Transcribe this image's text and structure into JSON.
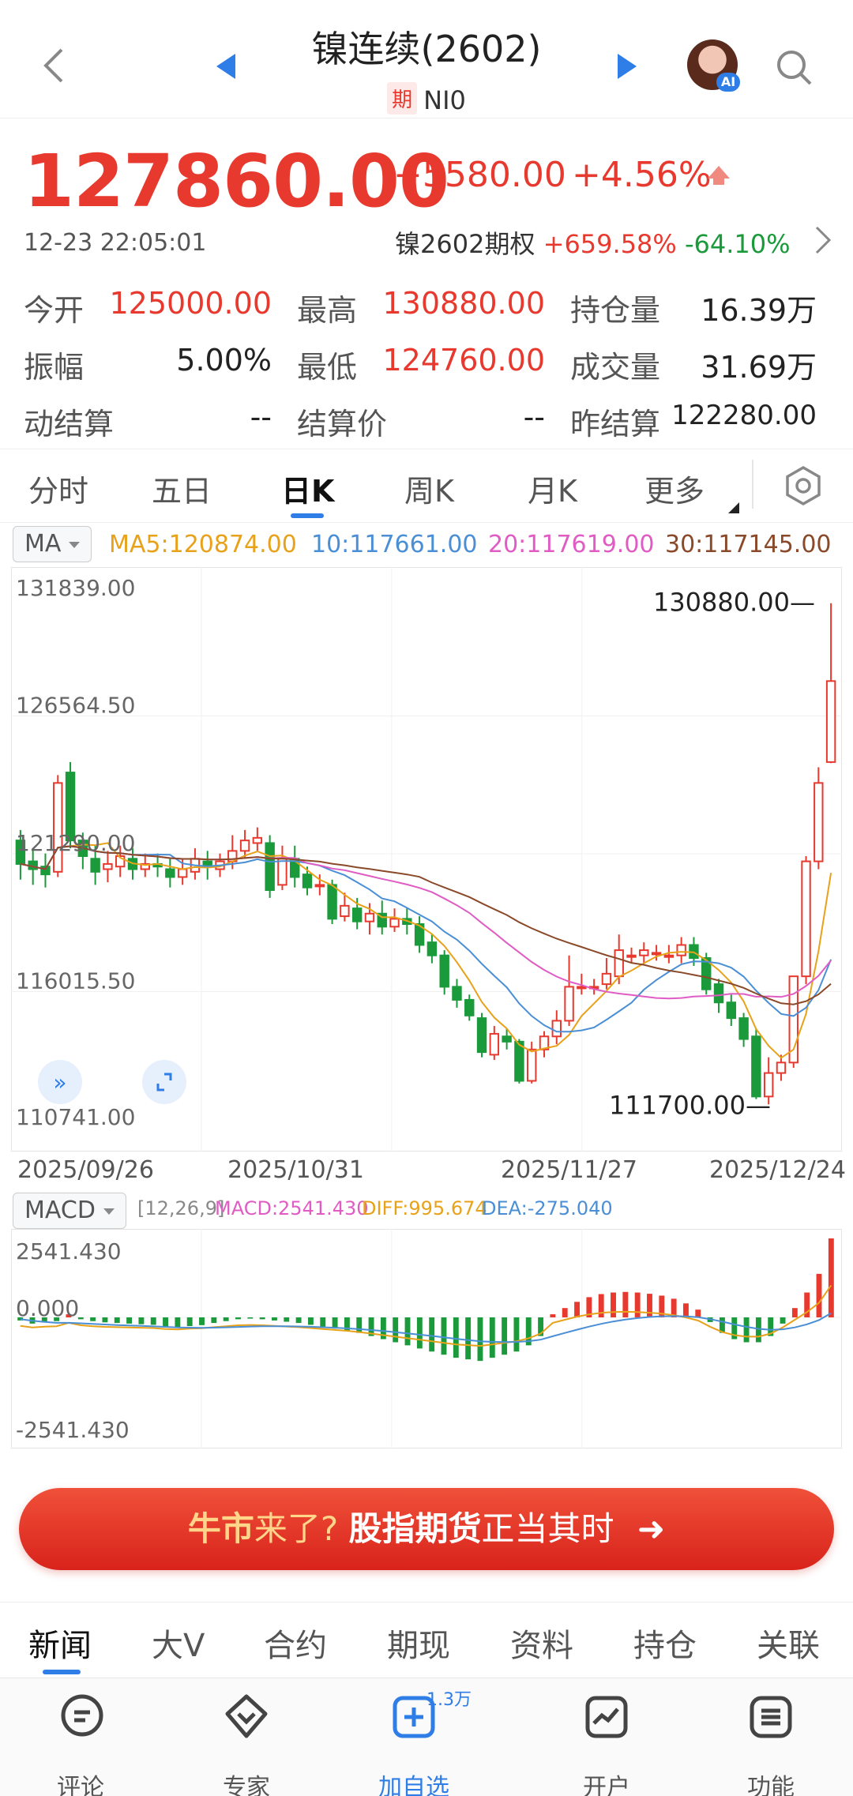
{
  "header": {
    "title": "镍连续(2602)",
    "tag": "期",
    "subtitle": "NI0",
    "ai_badge": "AI"
  },
  "quote": {
    "price": "127860.00",
    "change": "+5580.00",
    "change_pct": "+4.56%",
    "time": "12-23 22:05:01",
    "option_label": "镍2602期权",
    "option_up": "+659.58%",
    "option_down": "-64.10%"
  },
  "stats": [
    {
      "label": "今开",
      "value": "125000.00",
      "color": "red"
    },
    {
      "label": "最高",
      "value": "130880.00",
      "color": "red"
    },
    {
      "label": "持仓量",
      "value": "16.39万",
      "color": "black"
    },
    {
      "label": "振幅",
      "value": "5.00%",
      "color": "black"
    },
    {
      "label": "最低",
      "value": "124760.00",
      "color": "red"
    },
    {
      "label": "成交量",
      "value": "31.69万",
      "color": "black"
    },
    {
      "label": "动结算",
      "value": "--",
      "color": "black"
    },
    {
      "label": "结算价",
      "value": "--",
      "color": "black"
    },
    {
      "label": "昨结算",
      "value": "122280.00",
      "color": "black"
    }
  ],
  "tabs": [
    "分时",
    "五日",
    "日K",
    "周K",
    "月K",
    "更多"
  ],
  "active_tab": "日K",
  "indicators": {
    "ma_select": "MA",
    "ma5": "MA5:120874.00",
    "ma10": "10:117661.00",
    "ma20": "20:117619.00",
    "ma30": "30:117145.00",
    "macd_select": "MACD",
    "macd_params": "[12,26,9]",
    "macd_val": "MACD:2541.430",
    "diff_val": "DIFF:995.674",
    "dea_val": "DEA:-275.040"
  },
  "colors": {
    "up": "#e8392f",
    "down": "#1a9a3a",
    "ma5": "#e8a21a",
    "ma10": "#4a8fd6",
    "ma20": "#e05cc4",
    "ma30": "#8a4a2a",
    "accent": "#2f7de6"
  },
  "chart_data": [
    {
      "type": "candlestick",
      "y_ticks": [
        "131839.00",
        "126564.50",
        "121290.00",
        "116015.50",
        "110741.00"
      ],
      "ylim": [
        110741,
        131839
      ],
      "x_labels": [
        "2025/09/26",
        "2025/10/31",
        "2025/11/27",
        "2025/12/24"
      ],
      "annotations": {
        "high": "130880.00",
        "low": "111700.00"
      },
      "candles": [
        [
          121800,
          120900,
          122200,
          120300
        ],
        [
          121000,
          120700,
          121500,
          120100
        ],
        [
          120800,
          120500,
          121300,
          120000
        ],
        [
          120600,
          124000,
          124300,
          120400
        ],
        [
          124400,
          121800,
          124800,
          121500
        ],
        [
          121800,
          121200,
          122100,
          120700
        ],
        [
          121100,
          120600,
          121600,
          120100
        ],
        [
          120700,
          120900,
          121400,
          120200
        ],
        [
          120800,
          121200,
          121600,
          120400
        ],
        [
          121100,
          120700,
          121500,
          120300
        ],
        [
          120700,
          120900,
          121300,
          120400
        ],
        [
          120900,
          120800,
          121300,
          120400
        ],
        [
          120700,
          120400,
          121100,
          120000
        ],
        [
          120400,
          120700,
          121100,
          120100
        ],
        [
          120600,
          121100,
          121500,
          120300
        ],
        [
          121000,
          120800,
          121400,
          120300
        ],
        [
          120700,
          121000,
          121300,
          120400
        ],
        [
          121000,
          121400,
          122000,
          120700
        ],
        [
          121400,
          121800,
          122200,
          121100
        ],
        [
          121700,
          121900,
          122300,
          121400
        ],
        [
          121700,
          119900,
          122000,
          119600
        ],
        [
          120100,
          121100,
          121600,
          119900
        ],
        [
          121100,
          120400,
          121600,
          120000
        ],
        [
          120500,
          120000,
          120800,
          119700
        ],
        [
          120100,
          120100,
          120500,
          119700
        ],
        [
          120100,
          118800,
          120300,
          118600
        ],
        [
          118900,
          119300,
          119800,
          118700
        ],
        [
          119200,
          118700,
          119600,
          118400
        ],
        [
          118700,
          119000,
          119400,
          118200
        ],
        [
          119000,
          118500,
          119500,
          118200
        ],
        [
          118500,
          118800,
          119200,
          118300
        ],
        [
          118800,
          118600,
          119200,
          118200
        ],
        [
          118600,
          117800,
          118900,
          117500
        ],
        [
          117900,
          117400,
          118200,
          117100
        ],
        [
          117400,
          116200,
          117600,
          115900
        ],
        [
          116200,
          115700,
          116500,
          115400
        ],
        [
          115700,
          115100,
          115900,
          114900
        ],
        [
          115000,
          113700,
          115200,
          113500
        ],
        [
          113600,
          114400,
          114700,
          113400
        ],
        [
          114300,
          114100,
          114600,
          113800
        ],
        [
          114100,
          112600,
          114200,
          112500
        ],
        [
          112600,
          113800,
          114100,
          112500
        ],
        [
          113800,
          114300,
          114500,
          113500
        ],
        [
          114300,
          114900,
          115300,
          114000
        ],
        [
          114900,
          116200,
          117400,
          114700
        ],
        [
          116200,
          116200,
          116700,
          115900
        ],
        [
          116200,
          116200,
          116500,
          115900
        ],
        [
          116300,
          116700,
          117300,
          116100
        ],
        [
          116600,
          117600,
          118200,
          116300
        ],
        [
          117400,
          117400,
          117700,
          117100
        ],
        [
          117400,
          117600,
          117900,
          117100
        ],
        [
          117500,
          117500,
          117800,
          117200
        ],
        [
          117400,
          117400,
          117800,
          117100
        ],
        [
          117400,
          117800,
          118100,
          117100
        ],
        [
          117800,
          117300,
          118100,
          117000
        ],
        [
          117300,
          116100,
          117500,
          115900
        ],
        [
          116300,
          115600,
          116500,
          115200
        ],
        [
          115600,
          115000,
          115900,
          114700
        ],
        [
          115000,
          114200,
          115200,
          113900
        ],
        [
          114300,
          112000,
          114600,
          111900
        ],
        [
          112000,
          112900,
          113500,
          111700
        ],
        [
          112900,
          113300,
          113600,
          112600
        ],
        [
          113300,
          116600,
          116600,
          113100
        ],
        [
          116600,
          121000,
          121200,
          116300
        ],
        [
          121000,
          124000,
          124600,
          120700
        ],
        [
          124800,
          127900,
          130880,
          124760
        ]
      ],
      "ma5_last": 120874.0,
      "ma10_last": 117661.0,
      "ma20_last": 117619.0,
      "ma30_last": 117145.0
    },
    {
      "type": "bar",
      "name": "MACD",
      "y_ticks": [
        "2541.430",
        "0.000",
        "-2541.430"
      ],
      "ylim": [
        -2541.43,
        2541.43
      ],
      "values": [
        -100,
        -200,
        -150,
        -120,
        100,
        -60,
        -120,
        -160,
        -180,
        -200,
        -220,
        -240,
        -300,
        -330,
        -280,
        -250,
        -180,
        -120,
        -60,
        -40,
        -60,
        -100,
        -140,
        -180,
        -240,
        -300,
        -360,
        -420,
        -500,
        -600,
        -700,
        -800,
        -900,
        -1000,
        -1100,
        -1200,
        -1300,
        -1350,
        -1400,
        -1300,
        -1200,
        -1100,
        -900,
        -600,
        100,
        300,
        500,
        650,
        750,
        800,
        820,
        800,
        760,
        700,
        600,
        450,
        250,
        -150,
        -500,
        -700,
        -800,
        -800,
        -600,
        -200,
        300,
        800,
        1400,
        2541.43
      ],
      "diff_last": 995.674,
      "dea_last": -275.04
    }
  ],
  "banner": {
    "part1": "牛市",
    "part2": "来了?",
    "part3": "股指期货",
    "part4": "正当其时",
    "arrow": "➜"
  },
  "news_tabs": [
    "新闻",
    "大V",
    "合约",
    "期现",
    "资料",
    "持仓",
    "关联"
  ],
  "bottom_nav": [
    {
      "label": "评论",
      "icon": "comment-icon"
    },
    {
      "label": "专家",
      "icon": "expert-icon"
    },
    {
      "label": "加自选",
      "icon": "add-watchlist-icon"
    },
    {
      "label": "开户",
      "icon": "open-account-icon"
    },
    {
      "label": "功能",
      "icon": "function-icon"
    }
  ],
  "watch_count": "1.3万"
}
